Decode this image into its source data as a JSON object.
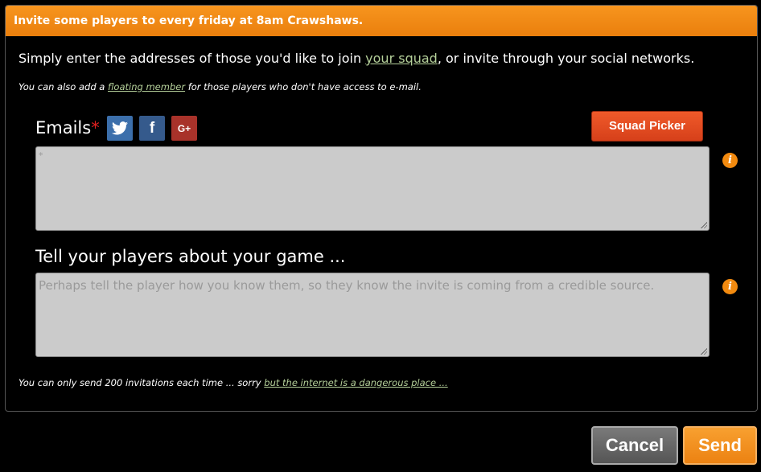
{
  "dialog": {
    "title": "Invite some players to every friday at 8am Crawshaws.",
    "intro": {
      "before": "Simply enter the addresses of those you'd like to join ",
      "link": "your squad",
      "after": ", or invite through your social networks."
    },
    "note": {
      "before": "You can also add a ",
      "link": "floating member",
      "after": " for those players who don't have access to e-mail."
    },
    "emails": {
      "label": "Emails",
      "required_mark": "*",
      "placeholder": "*",
      "social": [
        {
          "name": "twitter",
          "glyph": "twitter-bird"
        },
        {
          "name": "facebook",
          "glyph": "f"
        },
        {
          "name": "google-plus",
          "glyph": "G+"
        }
      ],
      "squad_picker_label": "Squad Picker",
      "info_glyph": "i"
    },
    "message": {
      "label": "Tell your players about your game ...",
      "placeholder": "Perhaps tell the player how you know them, so they know the invite is coming from a credible source.",
      "info_glyph": "i"
    },
    "footer_note": {
      "before": "You can only send 200 invitations each time ... sorry ",
      "link": "but the internet is a dangerous place ..."
    }
  },
  "actions": {
    "cancel_label": "Cancel",
    "send_label": "Send"
  },
  "colors": {
    "header": "#f7951e",
    "link": "#b5d09a",
    "squad_button": "#e44d22",
    "send_button": "#f59320",
    "info_icon": "#f28a0f"
  }
}
